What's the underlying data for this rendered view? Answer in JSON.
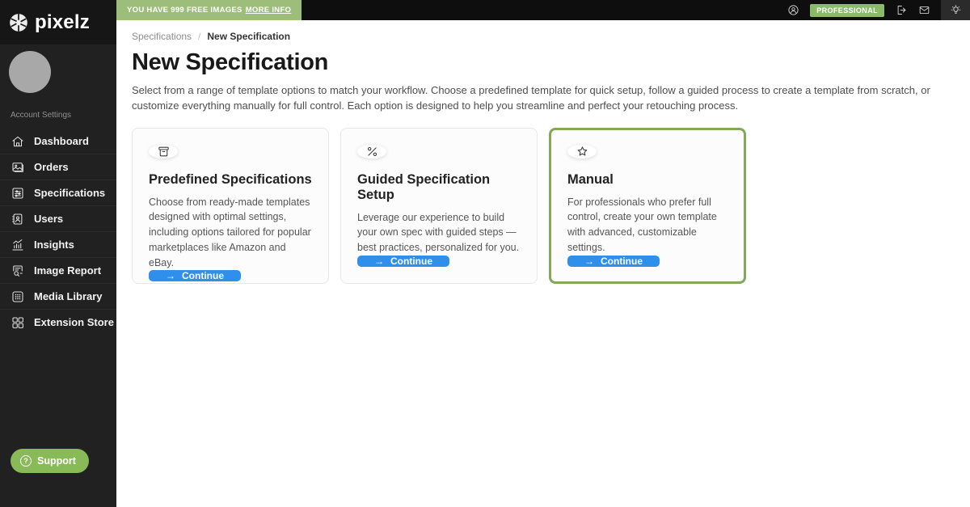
{
  "brand": {
    "name": "pixelz"
  },
  "topbar": {
    "free_images_text": "YOU HAVE 999 FREE IMAGES",
    "more_info_label": "MORE INFO",
    "plan_badge": "PROFESSIONAL"
  },
  "sidebar": {
    "section_label": "Account Settings",
    "items": [
      {
        "label": "Dashboard",
        "icon": "home-icon"
      },
      {
        "label": "Orders",
        "icon": "image-icon"
      },
      {
        "label": "Specifications",
        "icon": "sliders-icon"
      },
      {
        "label": "Users",
        "icon": "users-icon"
      },
      {
        "label": "Insights",
        "icon": "chart-icon"
      },
      {
        "label": "Image Report",
        "icon": "report-icon"
      },
      {
        "label": "Media Library",
        "icon": "media-grid-icon"
      },
      {
        "label": "Extension Store",
        "icon": "extensions-icon"
      }
    ],
    "support_label": "Support"
  },
  "breadcrumb": {
    "parent": "Specifications",
    "separator": "/",
    "current": "New Specification"
  },
  "page": {
    "title": "New Specification",
    "description": "Select from a range of template options to match your workflow. Choose a predefined template for quick setup, follow a guided process to create a template from scratch, or customize everything manually for full control. Each option is designed to help you streamline and perfect your retouching process."
  },
  "cards": [
    {
      "icon": "archive-box-icon",
      "title": "Predefined Specifications",
      "body": "Choose from ready-made templates designed with optimal settings, including options tailored for popular marketplaces like Amazon and eBay.",
      "button": "Continue",
      "selected": false
    },
    {
      "icon": "guided-steps-icon",
      "title": "Guided Specification Setup",
      "body": "Leverage our experience to build your own spec with guided steps — best practices, personalized for you.",
      "button": "Continue",
      "selected": false
    },
    {
      "icon": "star-icon",
      "title": "Manual",
      "body": "For professionals who prefer full control, create your own template with advanced, customizable settings.",
      "button": "Continue",
      "selected": true
    }
  ],
  "icons": {
    "arrow": "→",
    "question": "?"
  },
  "colors": {
    "accent_blue": "#2f8fea",
    "badge_green": "#9dbe7a",
    "plan_green": "#8cba68",
    "support_green": "#88ba57",
    "selected_border_green": "#80a95c"
  }
}
